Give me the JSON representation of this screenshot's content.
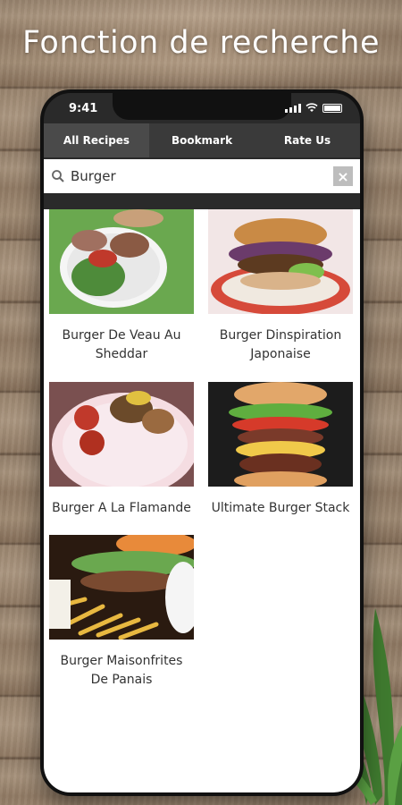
{
  "headline": "Fonction de recherche",
  "status": {
    "time": "9:41"
  },
  "tabs": [
    {
      "label": "All Recipes",
      "active": true
    },
    {
      "label": "Bookmark",
      "active": false
    },
    {
      "label": "Rate Us",
      "active": false
    }
  ],
  "search": {
    "value": "Burger",
    "icon": "search-icon",
    "clear_icon": "close-icon",
    "clear_label": "×"
  },
  "recipes": [
    {
      "title": "Burger De Veau Au Sheddar"
    },
    {
      "title": "Burger Dinspiration Japonaise"
    },
    {
      "title": "Burger A La Flamande"
    },
    {
      "title": "Ultimate Burger Stack"
    },
    {
      "title": "Burger Maisonfrites De Panais"
    }
  ],
  "colors": {
    "tab_bar": "#3a3a3a",
    "active_tab": "#4a4a4a",
    "content_bg": "#ffffff"
  }
}
